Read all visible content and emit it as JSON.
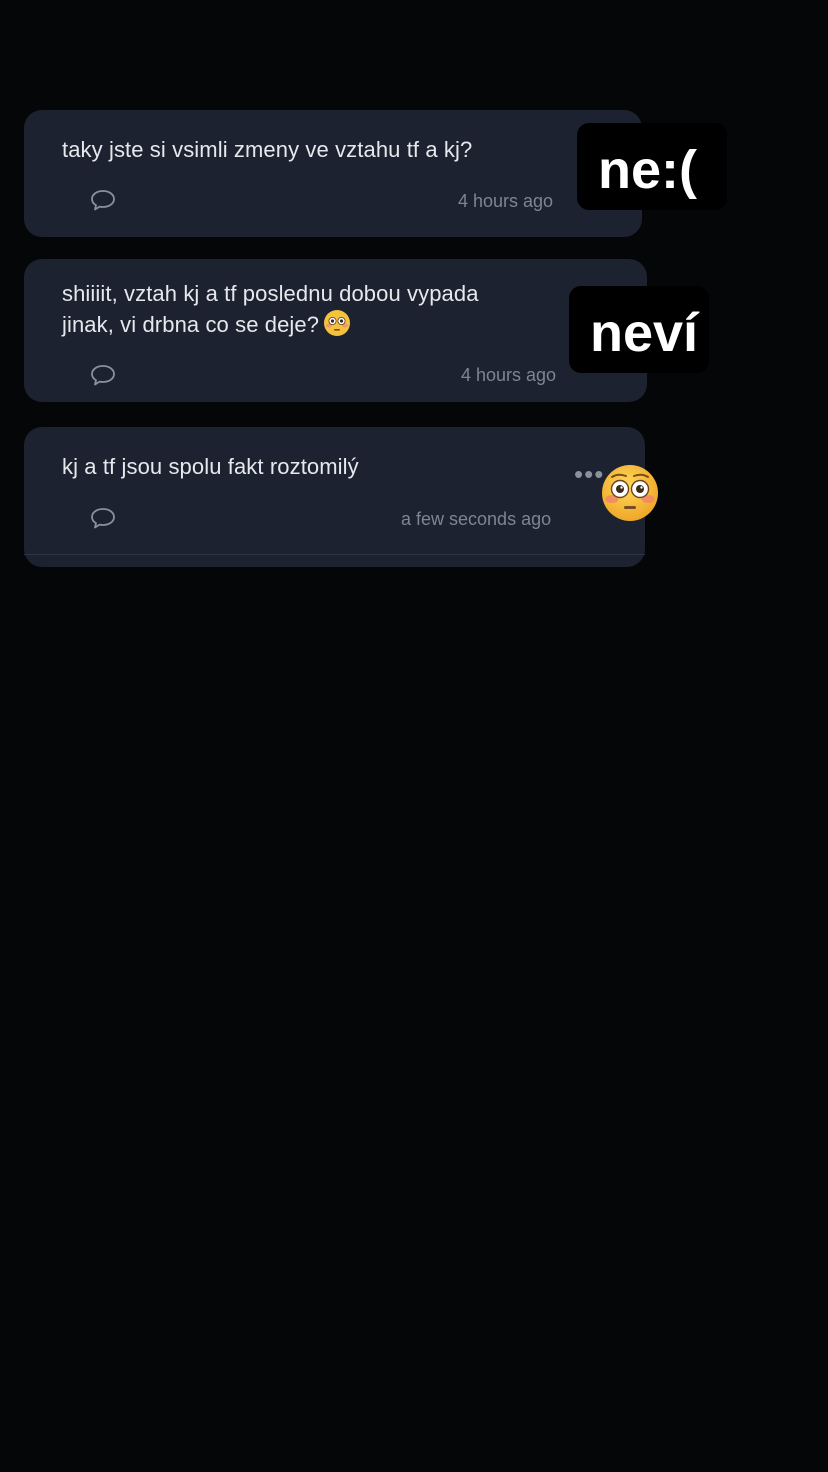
{
  "comments": [
    {
      "text": "taky jste si vsimli zmeny ve vztahu tf a kj?",
      "time": "4 hours ago",
      "icon": "comment-bubble-icon"
    },
    {
      "text_line1": "shiiiit, vztah kj a tf poslednu dobou vypada",
      "text_line2": "jinak, vi drbna co se deje?",
      "time": "4 hours ago",
      "icon": "comment-bubble-icon",
      "emoji": "flushed-face-emoji"
    },
    {
      "text": "kj a tf jsou spolu fakt roztomilý",
      "time": "a few seconds ago",
      "icon": "comment-bubble-icon",
      "more": "•••"
    }
  ],
  "stickers": {
    "first": "ne:(",
    "second": "neví",
    "emoji": "flushed-face-emoji"
  },
  "colors": {
    "background": "#050608",
    "card": "#1c2230",
    "text": "#e6e8ec",
    "muted": "#7d8594",
    "sticker_bg": "#000000",
    "sticker_text": "#ffffff"
  }
}
